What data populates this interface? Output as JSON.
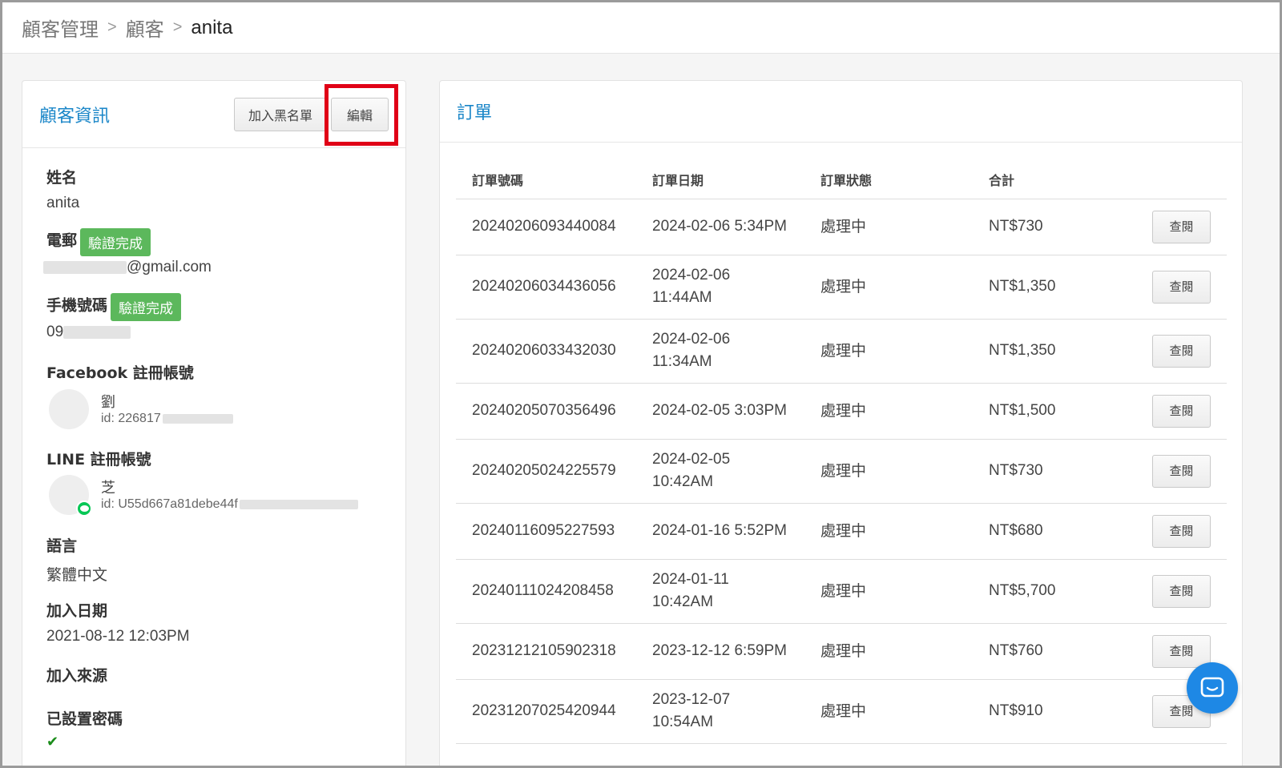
{
  "breadcrumb": [
    "顧客管理",
    "顧客",
    "anita"
  ],
  "customer_card": {
    "title": "顧客資訊",
    "blacklist_button": "加入黑名單",
    "edit_button": "編輯",
    "name_label": "姓名",
    "name_value": "anita",
    "email_label": "電郵",
    "email_badge": "驗證完成",
    "email_suffix": "@gmail.com",
    "phone_label": "手機號碼",
    "phone_badge": "驗證完成",
    "phone_prefix": "09",
    "facebook_label": "Facebook 註冊帳號",
    "facebook_name": "劉",
    "facebook_id": "id: 226817",
    "line_label": "LINE 註冊帳號",
    "line_name": "芝",
    "line_id": "id: U55d667a81debe44f",
    "language_label": "語言",
    "language_value": "繁體中文",
    "join_date_label": "加入日期",
    "join_date_value": "2021-08-12 12:03PM",
    "join_source_label": "加入來源",
    "password_label": "已設置密碼"
  },
  "orders_card": {
    "title": "訂單",
    "columns": [
      "訂單號碼",
      "訂單日期",
      "訂單狀態",
      "合計"
    ],
    "view_label": "查閱",
    "rows": [
      {
        "id": "20240206093440084",
        "date1": "2024-02-06 5:34PM",
        "date2": "",
        "status": "處理中",
        "total": "NT$730"
      },
      {
        "id": "20240206034436056",
        "date1": "2024-02-06",
        "date2": "11:44AM",
        "status": "處理中",
        "total": "NT$1,350"
      },
      {
        "id": "20240206033432030",
        "date1": "2024-02-06",
        "date2": "11:34AM",
        "status": "處理中",
        "total": "NT$1,350"
      },
      {
        "id": "20240205070356496",
        "date1": "2024-02-05 3:03PM",
        "date2": "",
        "status": "處理中",
        "total": "NT$1,500"
      },
      {
        "id": "20240205024225579",
        "date1": "2024-02-05",
        "date2": "10:42AM",
        "status": "處理中",
        "total": "NT$730"
      },
      {
        "id": "20240116095227593",
        "date1": "2024-01-16 5:52PM",
        "date2": "",
        "status": "處理中",
        "total": "NT$680"
      },
      {
        "id": "20240111024208458",
        "date1": "2024-01-11",
        "date2": "10:42AM",
        "status": "處理中",
        "total": "NT$5,700"
      },
      {
        "id": "20231212105902318",
        "date1": "2023-12-12 6:59PM",
        "date2": "",
        "status": "處理中",
        "total": "NT$760"
      },
      {
        "id": "20231207025420944",
        "date1": "2023-12-07",
        "date2": "10:54AM",
        "status": "處理中",
        "total": "NT$910"
      }
    ]
  },
  "icons": {
    "line": "line-icon",
    "check": "check-icon",
    "chat": "chat-icon"
  },
  "colors": {
    "title_blue": "#1a86c8",
    "badge_green": "#5cb85c",
    "highlight_red": "#e00016",
    "fab_blue": "#1e88e5"
  }
}
